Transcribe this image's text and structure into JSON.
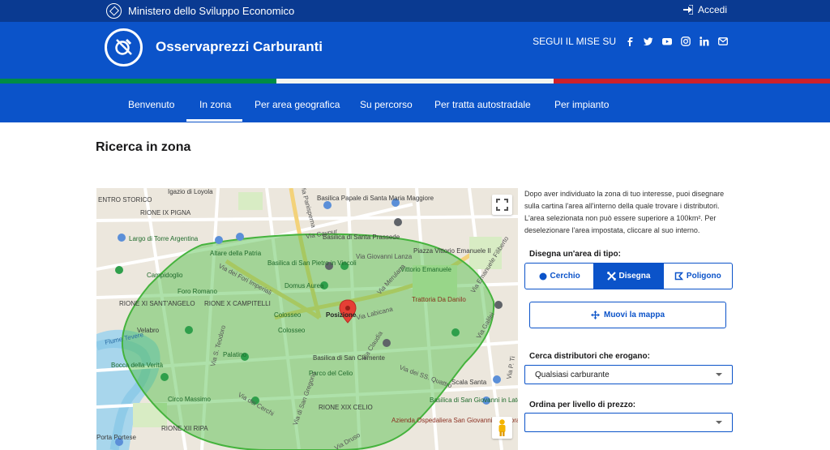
{
  "topbar": {
    "ministry": "Ministero dello Sviluppo Economico",
    "login": "Accedi"
  },
  "header": {
    "title": "Osservaprezzi Carburanti",
    "follow": "SEGUI IL MISE SU",
    "social": [
      "facebook-icon",
      "twitter-icon",
      "youtube-icon",
      "instagram-icon",
      "linkedin-icon",
      "email-icon"
    ]
  },
  "flag": [
    "#008c45",
    "#f4f5f0",
    "#cd212a"
  ],
  "nav": [
    {
      "label": "Benvenuto"
    },
    {
      "label": "In zona",
      "active": true
    },
    {
      "label": "Per area geografica"
    },
    {
      "label": "Su percorso"
    },
    {
      "label": "Per tratta autostradale"
    },
    {
      "label": "Per impianto"
    }
  ],
  "page_title": "Ricerca in zona",
  "map": {
    "labels": [
      "Basilica Papale di Santa Maria Maggiore",
      "Basilica di Santa Prassede",
      "Piazza Vittorio Emanuele II",
      "Vittorio Emanuele",
      "Trattoria Da Danilo",
      "Basilica di San Pietro in Vincoli",
      "Domus Aurea",
      "Altare della Patria",
      "Largo di Torre Argentina",
      "RIONE IX PIGNA",
      "ENTRO STORICO",
      "Igazio di Loyola",
      "Campidoglio",
      "Foro Romano",
      "RIONE XI SANT'ANGELO",
      "RIONE X CAMPITELLI",
      "Colosseo",
      "Colosseo",
      "Posizione",
      "Velabro",
      "Flume Tevere",
      "Palatino",
      "Basilica di San Clemente",
      "Parco del Celio",
      "Bocca della Verità",
      "Circo Massimo",
      "RIONE XIX CELIO",
      "Basilica di San Giovanni in Laterano",
      "Scala Santa",
      "RIONE XII RIPA",
      "Porta Portese",
      "Azienda Ospedaliera San Giovanni Addolorata",
      "Via Panisperna",
      "Via dei Fori Imperiali",
      "Via Labicana",
      "Via Merulana",
      "Via Cavour",
      "Via Giovanni Lanza",
      "Via dei Cerchi",
      "Via di San Gregorio",
      "Via Claudia",
      "Via dei SS. Quattro",
      "Via Druso",
      "Via S. Teodoro",
      "Via Emanuele Filiberto",
      "Via Galilei",
      "Via P. Ti"
    ],
    "colors": {
      "area": "#4cbc43",
      "road": "#f7e3a4",
      "water": "#8fcbe8",
      "marker": "#e53f35"
    },
    "marker_label": "Posizione",
    "controls": [
      "fullscreen-icon",
      "pegman-icon"
    ]
  },
  "sidebar": {
    "description": "Dopo aver individuato la zona di tuo interesse, puoi disegnare sulla cartina l'area all'interno della quale trovare i distributori. L'area selezionata non può essere superiore a 100km². Per deselezionare l'area impostata, cliccare al suo interno.",
    "draw_label": "Disegna un'area di tipo:",
    "draw_options": [
      {
        "label": "Cerchio",
        "icon": "circle-icon"
      },
      {
        "label": "Disegna",
        "icon": "draw-icon",
        "active": true
      },
      {
        "label": "Poligono",
        "icon": "polygon-icon"
      }
    ],
    "move_button": "Muovi la mappa",
    "fuel_label": "Cerca distributori che erogano:",
    "fuel_value": "Qualsiasi carburante",
    "price_label": "Ordina per livello di prezzo:",
    "price_value": ""
  }
}
